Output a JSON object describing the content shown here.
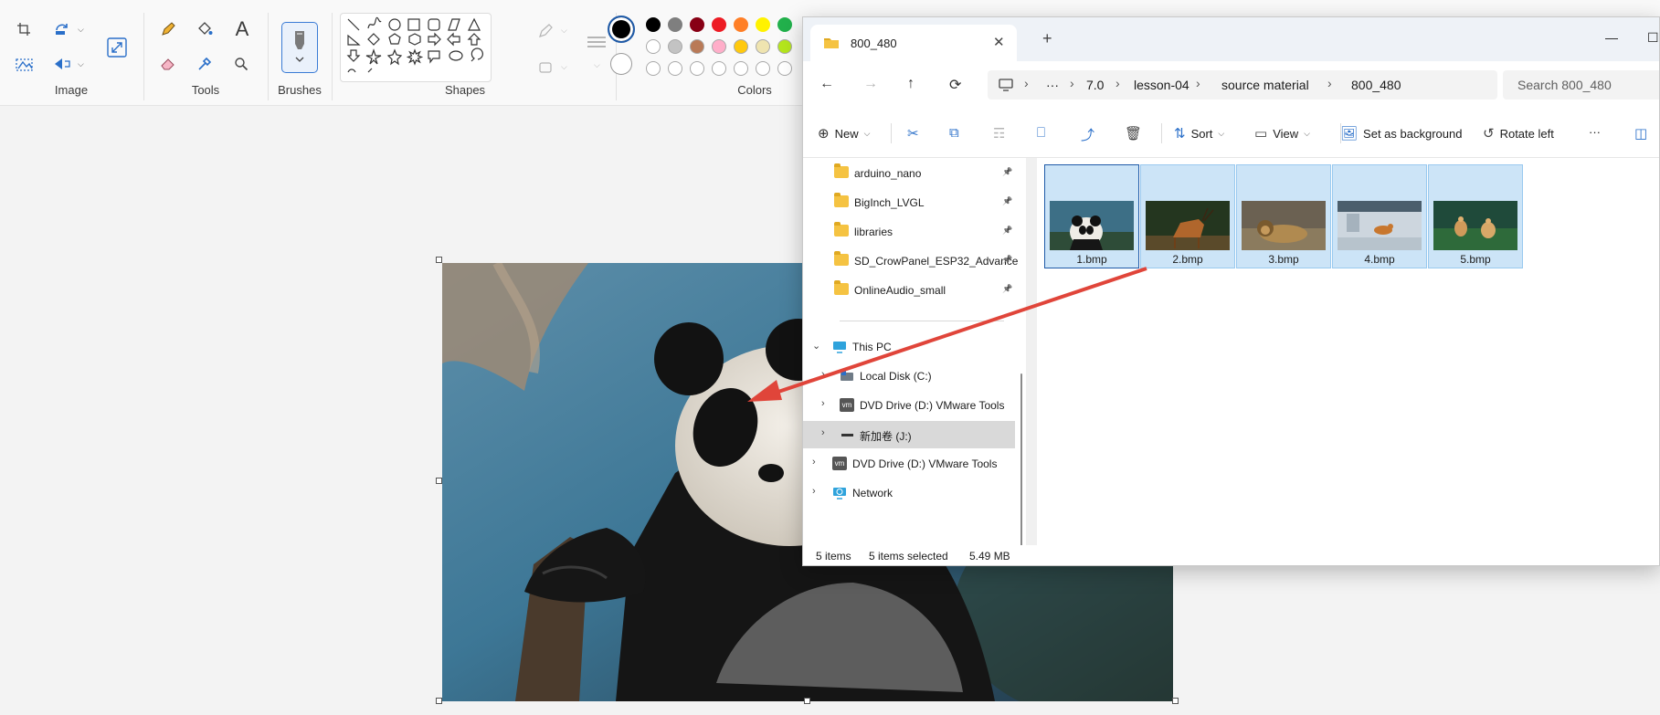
{
  "ribbon": {
    "groups": {
      "image": "Image",
      "tools": "Tools",
      "brushes": "Brushes",
      "shapes": "Shapes",
      "colors": "Colors"
    },
    "tools_text_icon": "A"
  },
  "colors": {
    "primary": "#000000",
    "secondary": "#ffffff",
    "palette_row1": [
      "#000000",
      "#7f7f7f",
      "#880015",
      "#ed1c24",
      "#ff7f27",
      "#fff200",
      "#22b14c"
    ],
    "palette_row2": [
      "#ffffff",
      "#c3c3c3",
      "#b97a57",
      "#ffaec9",
      "#ffc90e",
      "#efe4b0",
      "#b5e61d"
    ]
  },
  "explorer": {
    "tab_title": "800_480",
    "breadcrumbs": [
      "···",
      "7.0",
      "lesson-04",
      "source material",
      "800_480"
    ],
    "search_placeholder": "Search 800_480",
    "commands": {
      "new": "New",
      "sort": "Sort",
      "view": "View",
      "set_background": "Set as background",
      "rotate_left": "Rotate left",
      "more": "···"
    },
    "quick_access": [
      {
        "label": "arduino_nano"
      },
      {
        "label": "BigInch_LVGL"
      },
      {
        "label": "libraries"
      },
      {
        "label": "SD_CrowPanel_ESP32_Advance"
      },
      {
        "label": "OnlineAudio_small"
      }
    ],
    "tree": {
      "this_pc": "This PC",
      "local_disk": "Local Disk (C:)",
      "dvd_nested": "DVD Drive (D:) VMware Tools",
      "new_volume": "新加卷 (J:)",
      "dvd": "DVD Drive (D:) VMware Tools",
      "network": "Network",
      "vm_badge": "vm"
    },
    "files": [
      {
        "name": "1.bmp"
      },
      {
        "name": "2.bmp"
      },
      {
        "name": "3.bmp"
      },
      {
        "name": "4.bmp"
      },
      {
        "name": "5.bmp"
      }
    ],
    "status": {
      "items": "5 items",
      "selected": "5 items selected",
      "size": "5.49 MB"
    }
  }
}
